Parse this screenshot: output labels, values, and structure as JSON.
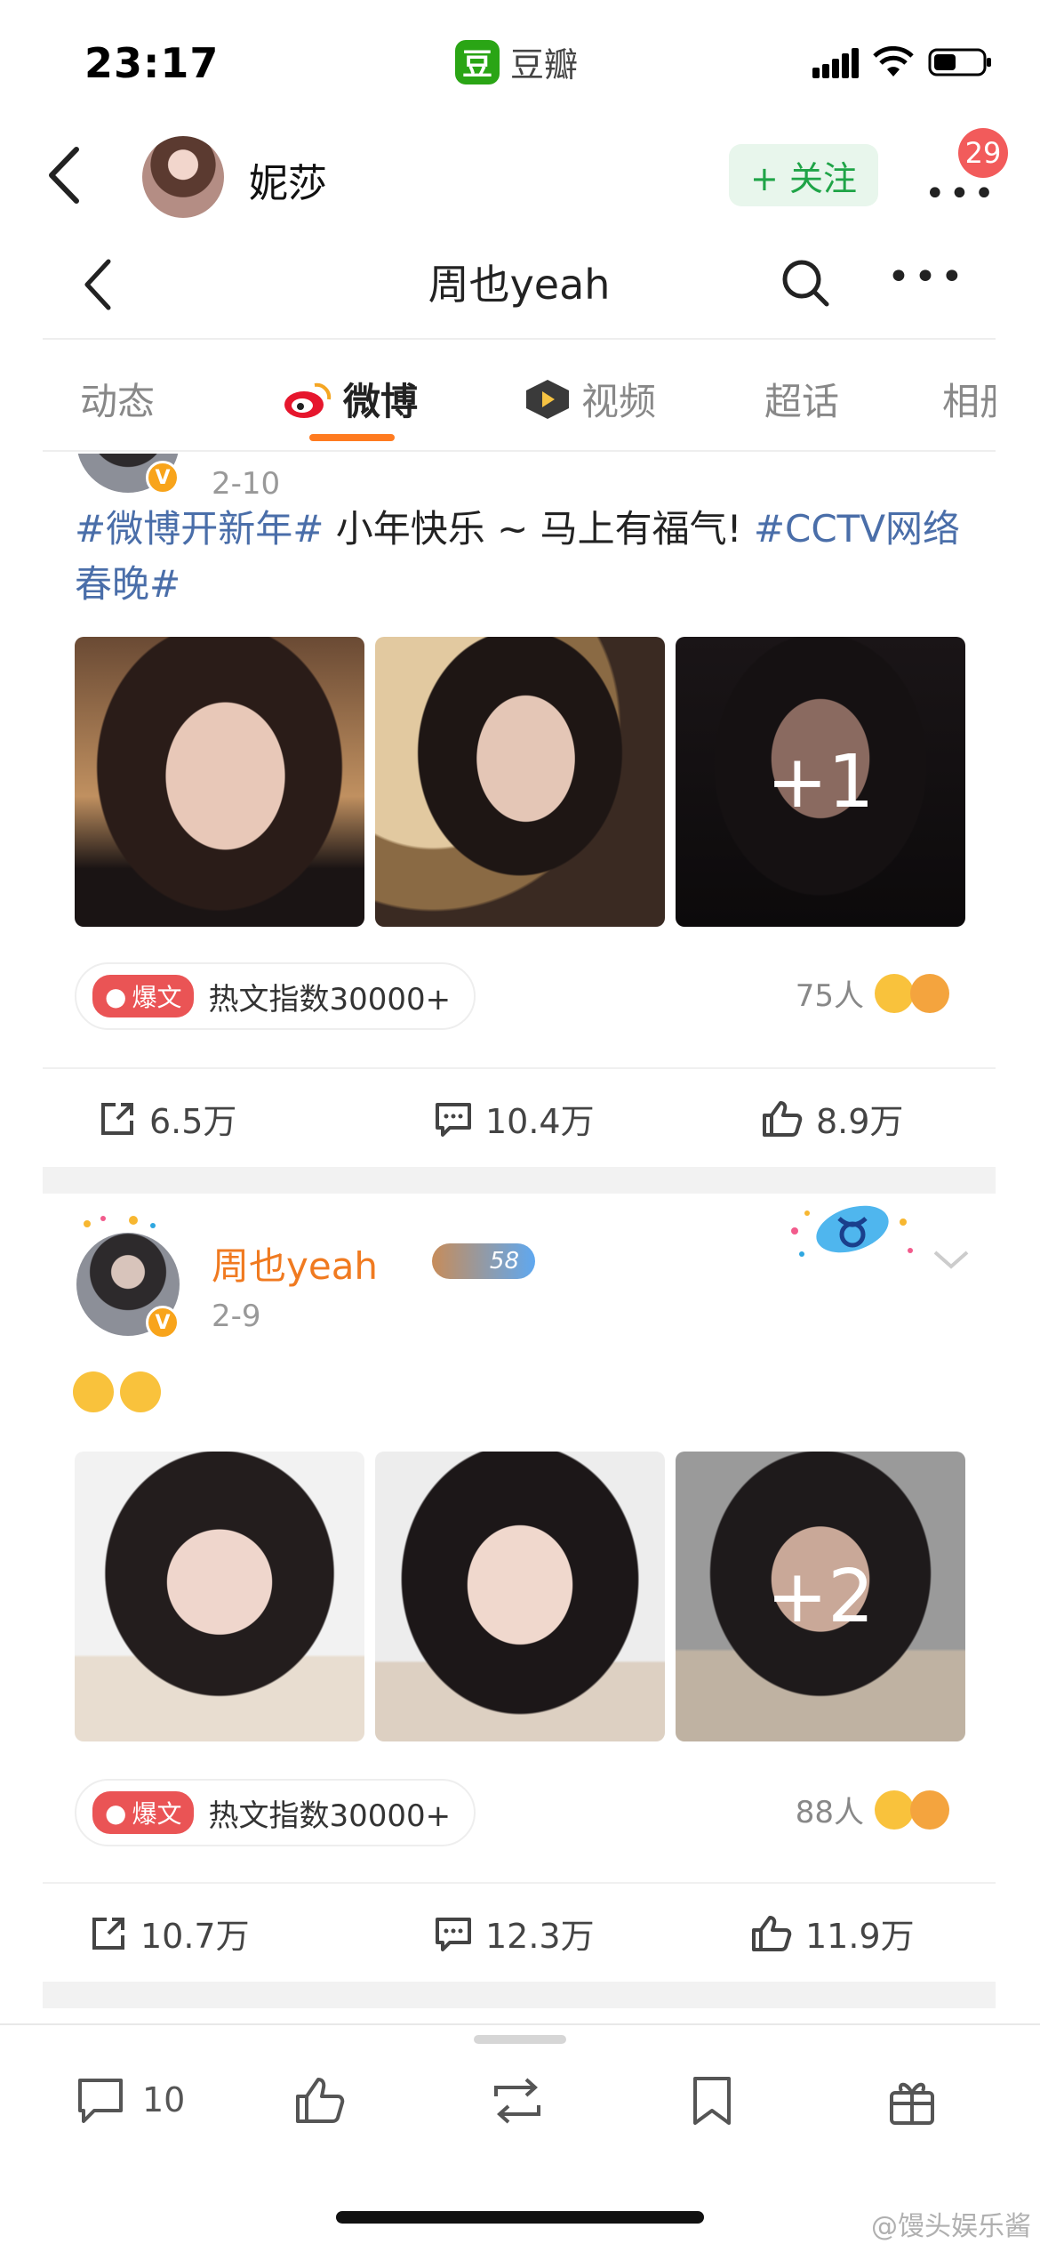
{
  "status": {
    "time": "23:17",
    "app_name": "豆瓣",
    "app_logo_char": "豆"
  },
  "douban_header": {
    "user_name": "妮莎",
    "follow_label": "+ 关注",
    "more_label": "•••",
    "notification_count": "29"
  },
  "weibo": {
    "title": "周也yeah",
    "more_label": "•••",
    "tabs": [
      {
        "label": "动态",
        "active": false
      },
      {
        "label": "微博",
        "active": true
      },
      {
        "label": "视频",
        "active": false
      },
      {
        "label": "超话",
        "active": false
      },
      {
        "label": "相册",
        "active": false
      }
    ]
  },
  "posts": [
    {
      "date": "2-10",
      "text_tag1": "#微博开新年#",
      "text_body": " 小年快乐 ~ 马上有福气! ",
      "text_tag2": "#CCTV网络春晚#",
      "more_images_label": "+1",
      "hot_tag_label": "爆文",
      "hot_index": "热文指数30000+",
      "people": "75人",
      "reposts": "6.5万",
      "comments": "10.4万",
      "likes": "8.9万"
    },
    {
      "author": "周也yeah",
      "level": "58",
      "date": "2-9",
      "more_images_label": "+2",
      "hot_tag_label": "爆文",
      "hot_index": "热文指数30000+",
      "people": "88人",
      "reposts": "10.7万",
      "comments": "12.3万",
      "likes": "11.9万"
    }
  ],
  "bottom_bar": {
    "comment_count": "10"
  },
  "watermark": "@馒头娱乐酱"
}
